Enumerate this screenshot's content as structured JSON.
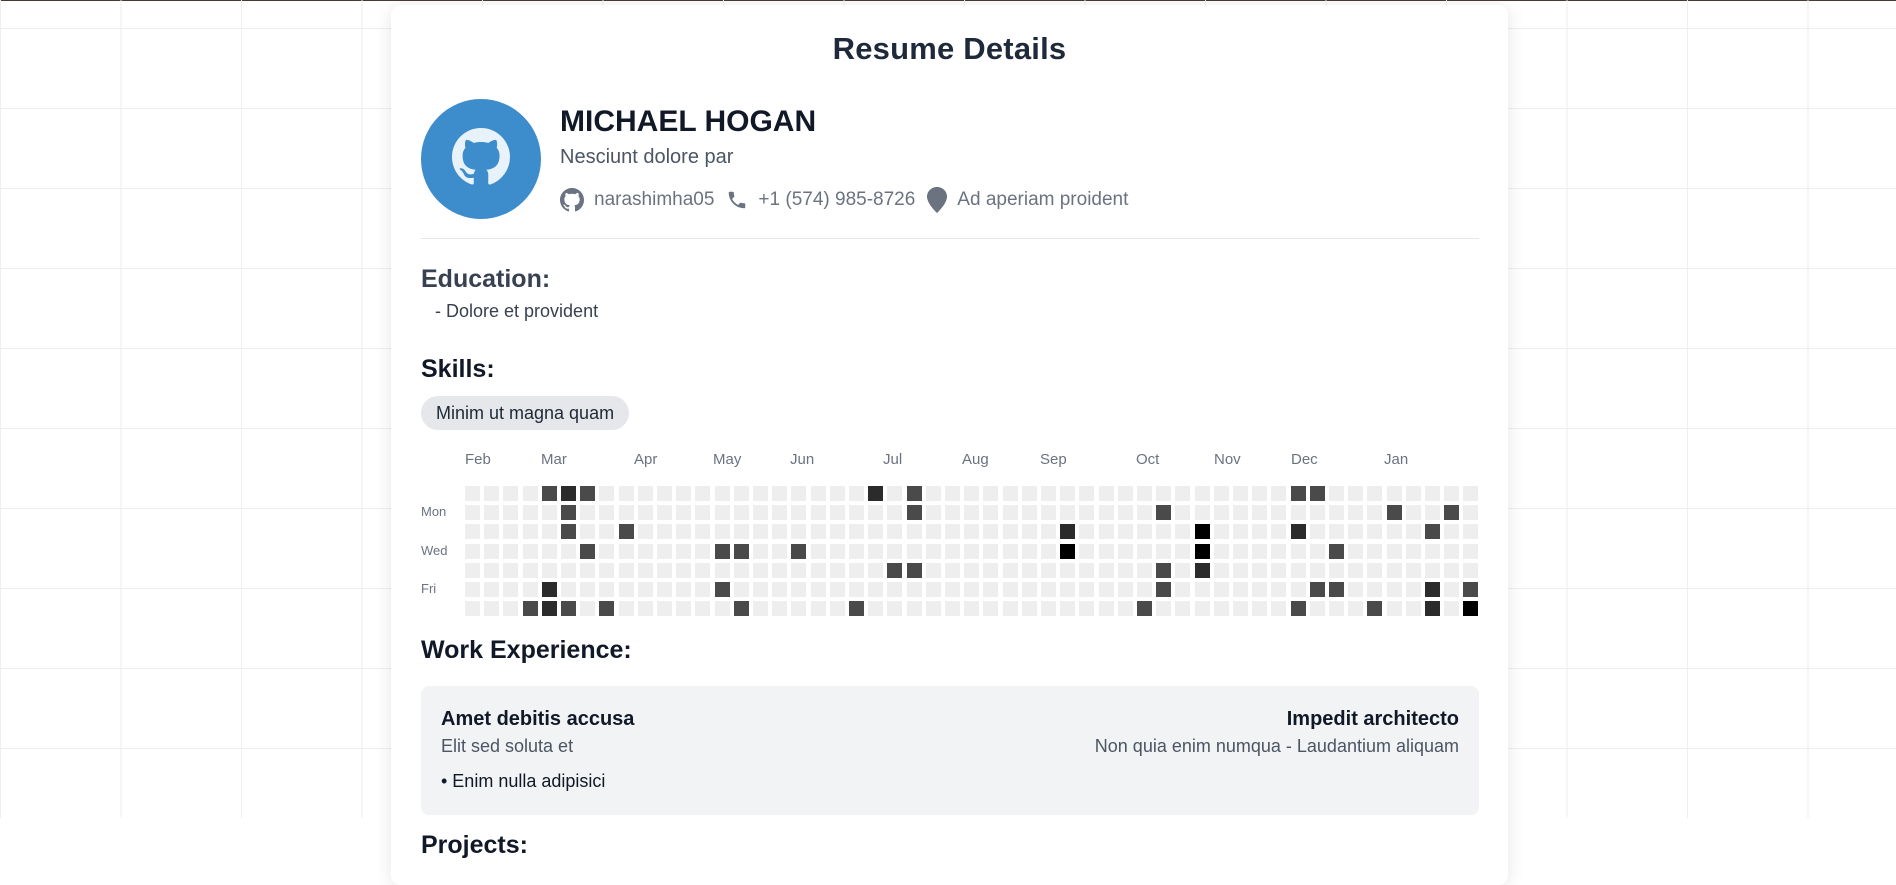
{
  "page": {
    "title": "Resume Details"
  },
  "profile": {
    "name": "MICHAEL HOGAN",
    "headline": "Nesciunt dolore par",
    "github": "narashimha05",
    "phone": "+1 (574) 985-8726",
    "location": "Ad aperiam proident",
    "avatar_icon": "github-icon",
    "avatar_color": "#3d8ccc"
  },
  "education": {
    "title": "Education:",
    "items": [
      "- Dolore et provident"
    ]
  },
  "skills": {
    "title": "Skills:",
    "items": [
      "Minim ut magna quam"
    ]
  },
  "activity": {
    "months": [
      "Feb",
      "Mar",
      "Apr",
      "May",
      "Jun",
      "Jul",
      "Aug",
      "Sep",
      "Oct",
      "Nov",
      "Dec",
      "Jan"
    ],
    "day_labels": [
      "Mon",
      "Wed",
      "Fri"
    ],
    "weeks": 53,
    "levels": [
      "#eeeeee",
      "#4a4a4a",
      "#2b2b2b",
      "#000000"
    ],
    "active_cells": [
      [
        4,
        0,
        1
      ],
      [
        5,
        0,
        2
      ],
      [
        6,
        0,
        1
      ],
      [
        21,
        0,
        2
      ],
      [
        23,
        0,
        1
      ],
      [
        43,
        0,
        1
      ],
      [
        44,
        0,
        1
      ],
      [
        5,
        1,
        1
      ],
      [
        23,
        1,
        1
      ],
      [
        36,
        1,
        1
      ],
      [
        48,
        1,
        1
      ],
      [
        51,
        1,
        1
      ],
      [
        5,
        2,
        1
      ],
      [
        8,
        2,
        1
      ],
      [
        31,
        2,
        2
      ],
      [
        38,
        2,
        3
      ],
      [
        43,
        2,
        2
      ],
      [
        50,
        2,
        1
      ],
      [
        6,
        3,
        1
      ],
      [
        13,
        3,
        1
      ],
      [
        14,
        3,
        1
      ],
      [
        17,
        3,
        1
      ],
      [
        31,
        3,
        3
      ],
      [
        38,
        3,
        3
      ],
      [
        45,
        3,
        1
      ],
      [
        22,
        4,
        1
      ],
      [
        23,
        4,
        1
      ],
      [
        36,
        4,
        1
      ],
      [
        38,
        4,
        2
      ],
      [
        4,
        5,
        2
      ],
      [
        13,
        5,
        1
      ],
      [
        36,
        5,
        1
      ],
      [
        44,
        5,
        1
      ],
      [
        45,
        5,
        1
      ],
      [
        50,
        5,
        2
      ],
      [
        52,
        5,
        1
      ],
      [
        3,
        6,
        1
      ],
      [
        4,
        6,
        2
      ],
      [
        5,
        6,
        1
      ],
      [
        7,
        6,
        1
      ],
      [
        14,
        6,
        1
      ],
      [
        20,
        6,
        1
      ],
      [
        35,
        6,
        1
      ],
      [
        43,
        6,
        1
      ],
      [
        47,
        6,
        1
      ],
      [
        50,
        6,
        2
      ],
      [
        52,
        6,
        3
      ]
    ]
  },
  "work": {
    "title": "Work Experience:",
    "jobs": [
      {
        "title": "Amet debitis accusa",
        "subtitle": "Elit sed soluta et",
        "company": "Impedit architecto",
        "meta": "Non quia enim numqua - Laudantium aliquam",
        "bullets": [
          "• Enim nulla adipisici"
        ]
      }
    ]
  },
  "projects": {
    "title": "Projects:"
  }
}
